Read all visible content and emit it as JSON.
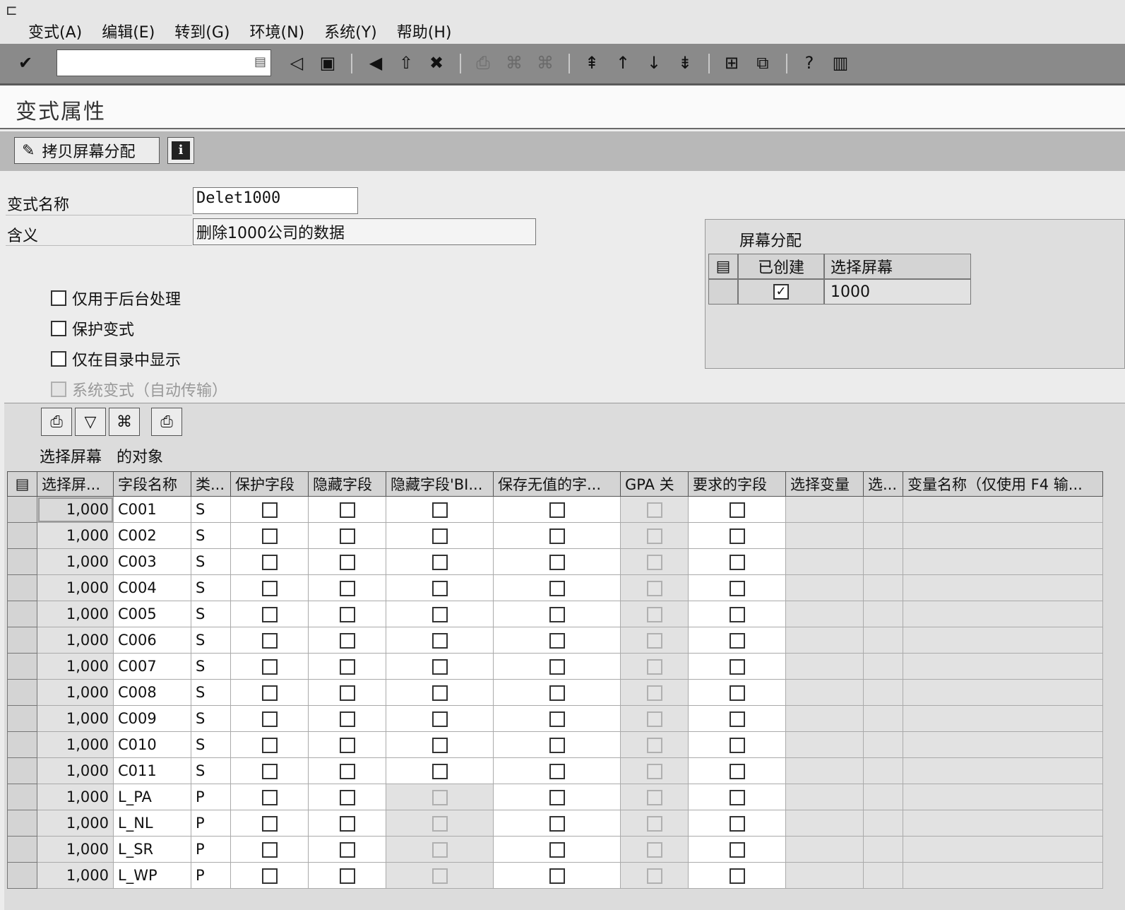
{
  "menu": {
    "items": [
      "变式(A)",
      "编辑(E)",
      "转到(G)",
      "环境(N)",
      "系统(Y)",
      "帮助(H)"
    ]
  },
  "toolbar": {
    "command_value": "",
    "icons": [
      "enter-icon",
      "save-icon",
      "back-icon",
      "exit-icon",
      "cancel-icon",
      "print-icon",
      "find-icon",
      "find-next-icon",
      "first-page-icon",
      "prev-page-icon",
      "next-page-icon",
      "last-page-icon",
      "new-session-icon",
      "shortcut-icon",
      "help-icon",
      "layout-icon"
    ]
  },
  "page": {
    "title": "变式属性"
  },
  "app_toolbar": {
    "copy_label": "拷贝屏幕分配",
    "info_label": "i"
  },
  "form": {
    "variant_name_label": "变式名称",
    "variant_name_value": "Delet1000",
    "meaning_label": "含义",
    "meaning_value": "删除1000公司的数据",
    "options": [
      {
        "label": "仅用于后台处理",
        "checked": false,
        "disabled": false
      },
      {
        "label": "保护变式",
        "checked": false,
        "disabled": false
      },
      {
        "label": "仅在目录中显示",
        "checked": false,
        "disabled": false
      },
      {
        "label": "系统变式（自动传输）",
        "checked": false,
        "disabled": true
      }
    ]
  },
  "assignment": {
    "title": "屏幕分配",
    "col_created": "已创建",
    "col_screen": "选择屏幕",
    "row": {
      "created": true,
      "screen": "1000"
    }
  },
  "table": {
    "title": "选择屏幕   的对象",
    "columns": [
      "选择屏...",
      "字段名称",
      "类...",
      "保护字段",
      "隐藏字段",
      "隐藏字段'BI...",
      "保存无值的字...",
      "GPA 关",
      "要求的字段",
      "选择变量",
      "选...",
      "变量名称（仅使用 F4 输..."
    ],
    "rows": [
      {
        "screen": "1,000",
        "field": "C001",
        "type": "S"
      },
      {
        "screen": "1,000",
        "field": "C002",
        "type": "S"
      },
      {
        "screen": "1,000",
        "field": "C003",
        "type": "S"
      },
      {
        "screen": "1,000",
        "field": "C004",
        "type": "S"
      },
      {
        "screen": "1,000",
        "field": "C005",
        "type": "S"
      },
      {
        "screen": "1,000",
        "field": "C006",
        "type": "S"
      },
      {
        "screen": "1,000",
        "field": "C007",
        "type": "S"
      },
      {
        "screen": "1,000",
        "field": "C008",
        "type": "S"
      },
      {
        "screen": "1,000",
        "field": "C009",
        "type": "S"
      },
      {
        "screen": "1,000",
        "field": "C010",
        "type": "S"
      },
      {
        "screen": "1,000",
        "field": "C011",
        "type": "S"
      },
      {
        "screen": "1,000",
        "field": "L_PA",
        "type": "P"
      },
      {
        "screen": "1,000",
        "field": "L_NL",
        "type": "P"
      },
      {
        "screen": "1,000",
        "field": "L_SR",
        "type": "P"
      },
      {
        "screen": "1,000",
        "field": "L_WP",
        "type": "P"
      }
    ]
  }
}
